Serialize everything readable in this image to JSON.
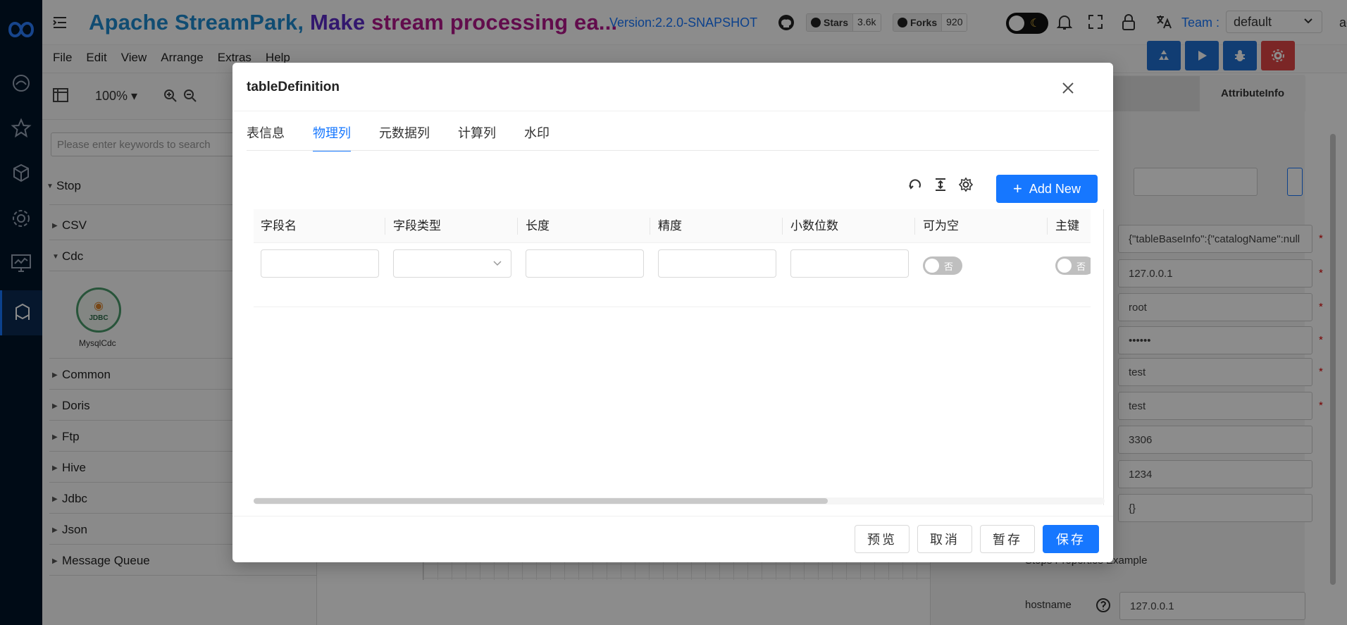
{
  "header": {
    "title_part1": "Apache StreamPark,",
    "title_part2": "Make",
    "title_part3": "stream processing ea...",
    "version": "Version:2.2.0-SNAPSHOT",
    "stars_label": "Stars",
    "stars_count": "3.6k",
    "forks_label": "Forks",
    "forks_count": "920",
    "team_label": "Team :",
    "team_value": "default",
    "user": "admin"
  },
  "menubar": [
    "File",
    "Edit",
    "View",
    "Arrange",
    "Extras",
    "Help"
  ],
  "toolbar": {
    "zoom": "100%"
  },
  "sidebar": {
    "search_placeholder": "Please enter keywords to search",
    "groups": [
      "Stop",
      "CSV",
      "Cdc",
      "Common",
      "Doris",
      "Ftp",
      "Hive",
      "Jdbc",
      "Json",
      "Message Queue"
    ],
    "node_label": "MysqlCdc",
    "node_badge": "JDBC"
  },
  "right_panel": {
    "tab_attribute": "AttributeInfo",
    "fields": [
      "{\"tableBaseInfo\":{\"catalogName\":null",
      "127.0.0.1",
      "root",
      "••••••",
      "test",
      "test",
      "3306",
      "1234",
      "{}"
    ],
    "example_label": "Stops Properties Example",
    "hostname_label": "hostname",
    "hostname_value": "127.0.0.1"
  },
  "modal": {
    "title": "tableDefinition",
    "tabs": [
      "表信息",
      "物理列",
      "元数据列",
      "计算列",
      "水印"
    ],
    "active_tab": "物理列",
    "add_new": "Add New",
    "columns": [
      "字段名",
      "字段类型",
      "长度",
      "精度",
      "小数位数",
      "可为空",
      "主键"
    ],
    "switch_off_label": "否",
    "footer": {
      "preview": "预览",
      "cancel": "取消",
      "draft": "暂存",
      "save": "保存"
    }
  },
  "colors": {
    "primary": "#1677ff",
    "danger": "#e04545",
    "rail": "#001529"
  }
}
